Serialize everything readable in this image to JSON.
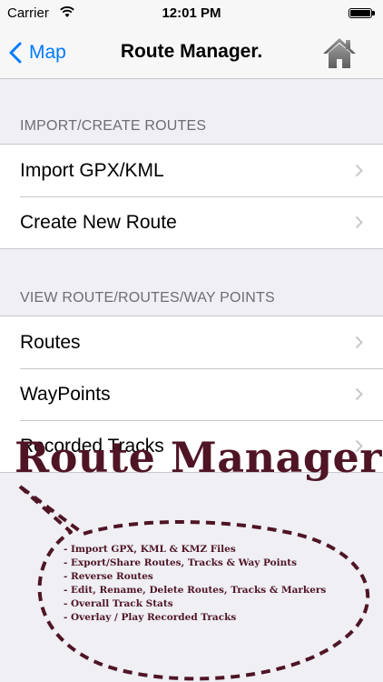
{
  "status_bar": {
    "carrier": "Carrier",
    "time": "12:01 PM",
    "battery_level": 1.0
  },
  "nav": {
    "back_label": "Map",
    "title": "Route Manager.",
    "home_icon": "home-icon"
  },
  "sections": [
    {
      "header": "IMPORT/CREATE ROUTES",
      "rows": [
        "Import GPX/KML",
        "Create New Route"
      ]
    },
    {
      "header": "VIEW ROUTE/ROUTES/WAY POINTS",
      "rows": [
        "Routes",
        "WayPoints",
        "Recorded Tracks"
      ]
    }
  ],
  "promo": {
    "title": "Route Manager",
    "features": [
      "- Import GPX, KML & KMZ Files",
      "- Export/Share Routes, Tracks & Way Points",
      "- Reverse Routes",
      "- Edit, Rename, Delete Routes, Tracks & Markers",
      "- Overall Track Stats",
      "- Overlay / Play Recorded Tracks"
    ]
  },
  "colors": {
    "accent": "#007aff",
    "promo": "#4f1525",
    "background": "#efeff4"
  }
}
